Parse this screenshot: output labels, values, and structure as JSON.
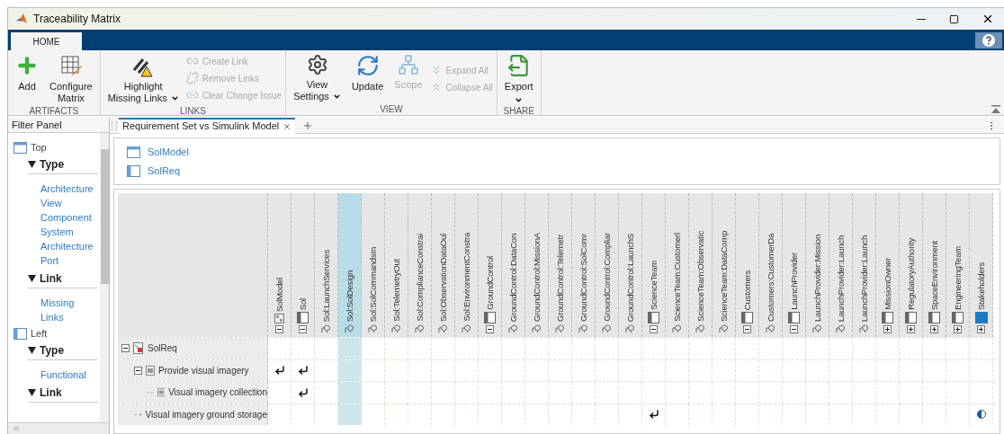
{
  "window": {
    "title": "Traceability Matrix"
  },
  "ribbon": {
    "tabs": [
      {
        "label": "HOME",
        "selected": true
      }
    ],
    "groups": [
      {
        "label": "ARTIFACTS",
        "items": [
          {
            "kind": "large",
            "lines": [
              "Add"
            ],
            "disabled": false,
            "dropdown": false
          },
          {
            "kind": "large",
            "lines": [
              "Configure",
              "Matrix"
            ],
            "disabled": false,
            "dropdown": false
          }
        ]
      },
      {
        "label": "LINKS",
        "items": [
          {
            "kind": "large",
            "lines": [
              "Highlight",
              "Missing Links"
            ],
            "disabled": false,
            "dropdown": true
          },
          {
            "kind": "stack",
            "items": [
              {
                "label": "Create Link",
                "disabled": true
              },
              {
                "label": "Remove Links",
                "disabled": true
              },
              {
                "label": "Clear Change Issue",
                "disabled": true
              }
            ]
          }
        ]
      },
      {
        "label": "VIEW",
        "items": [
          {
            "kind": "large",
            "lines": [
              "View",
              "Settings"
            ],
            "disabled": false,
            "dropdown": true
          },
          {
            "kind": "large",
            "lines": [
              "Update"
            ],
            "disabled": false,
            "dropdown": false
          },
          {
            "kind": "large",
            "lines": [
              "Scope"
            ],
            "disabled": true,
            "dropdown": false
          },
          {
            "kind": "stack",
            "items": [
              {
                "label": "Expand All",
                "disabled": true
              },
              {
                "label": "Collapse All",
                "disabled": true
              }
            ]
          }
        ]
      },
      {
        "label": "SHARE",
        "items": [
          {
            "kind": "large",
            "lines": [
              "Export"
            ],
            "disabled": false,
            "dropdown": true
          }
        ]
      }
    ]
  },
  "filter_panel": {
    "title": "Filter Panel",
    "sections": [
      {
        "label": "Top",
        "kind": "top",
        "groups": [
          {
            "label": "Type",
            "expanded": true,
            "items": [
              "Architecture View",
              "Component",
              "System Architecture Port"
            ]
          },
          {
            "label": "Link",
            "expanded": true,
            "items": [
              "Missing Links"
            ]
          }
        ]
      },
      {
        "label": "Left",
        "kind": "left",
        "groups": [
          {
            "label": "Type",
            "expanded": true,
            "items": [
              "Functional"
            ]
          },
          {
            "label": "Link",
            "expanded": true
          }
        ]
      }
    ]
  },
  "document_tabs": [
    {
      "label": "Requirement Set vs Simulink Model",
      "selected": true
    }
  ],
  "legend": [
    {
      "label": "SolModel",
      "kind": "top"
    },
    {
      "label": "SolReq",
      "kind": "left"
    }
  ],
  "matrix": {
    "columns": [
      {
        "label": "SolModel",
        "kind": "model",
        "expanded": true,
        "selected": false
      },
      {
        "label": "Sol",
        "kind": "component",
        "expanded": true,
        "selected": false
      },
      {
        "label": "Sol:LaunchServices",
        "kind": "port",
        "selected": false
      },
      {
        "label": "Sol:SolDesign",
        "kind": "port",
        "selected": true
      },
      {
        "label": "Sol:SolCommandsIn",
        "kind": "port",
        "selected": false
      },
      {
        "label": "Sol:TelemetryOut",
        "kind": "port",
        "selected": false
      },
      {
        "label": "Sol:ComplianceConstrai",
        "kind": "port",
        "selected": false
      },
      {
        "label": "Sol:ObservationDataOul",
        "kind": "port",
        "selected": false
      },
      {
        "label": "Sol:EnvironmentConstra",
        "kind": "port",
        "selected": false
      },
      {
        "label": "GroundControl",
        "kind": "component",
        "expanded": true,
        "selected": false
      },
      {
        "label": "GroundControl:DataCon",
        "kind": "port",
        "selected": false
      },
      {
        "label": "GroundControl:MissionA",
        "kind": "port",
        "selected": false
      },
      {
        "label": "GroundControl:Telemetr",
        "kind": "port",
        "selected": false
      },
      {
        "label": "GroundControl:SolComr",
        "kind": "port",
        "selected": false
      },
      {
        "label": "GroundControl:Compliar",
        "kind": "port",
        "selected": false
      },
      {
        "label": "GroundControl:LaunchS",
        "kind": "port",
        "selected": false
      },
      {
        "label": "ScienceTeam",
        "kind": "component",
        "expanded": true,
        "selected": false
      },
      {
        "label": "ScienceTeam:Customerl",
        "kind": "port",
        "selected": false
      },
      {
        "label": "ScienceTeam:Observatic",
        "kind": "port",
        "selected": false
      },
      {
        "label": "ScienceTeam:DataComp",
        "kind": "port",
        "selected": false
      },
      {
        "label": "Customers",
        "kind": "component",
        "expanded": true,
        "selected": false
      },
      {
        "label": "Customers:CustomerDa",
        "kind": "port",
        "selected": false
      },
      {
        "label": "LaunchProvider",
        "kind": "component",
        "expanded": true,
        "selected": false
      },
      {
        "label": "LaunchProvider:Mission",
        "kind": "port",
        "selected": false
      },
      {
        "label": "LaunchProvider:Launch",
        "kind": "port",
        "selected": false
      },
      {
        "label": "LaunchProvider:Launch",
        "kind": "port",
        "selected": false
      },
      {
        "label": "MissionOwner",
        "kind": "component",
        "expanded": false,
        "selected": false
      },
      {
        "label": "RegulatoryAuthority",
        "kind": "component",
        "expanded": false,
        "selected": false
      },
      {
        "label": "SpaceEnvironment",
        "kind": "component",
        "expanded": false,
        "selected": false
      },
      {
        "label": "EngineeringTeam",
        "kind": "component",
        "expanded": false,
        "selected": false
      },
      {
        "label": "Stakeholders",
        "kind": "stakeholder",
        "expanded": false,
        "selected": false
      }
    ],
    "rows": [
      {
        "label": "SolReq",
        "kind": "set",
        "expanded": true,
        "children": [
          {
            "label": "Provide visual imagery",
            "kind": "requirement",
            "expanded": true,
            "cells": [
              {
                "kind": "link"
              },
              {
                "kind": "link"
              }
            ],
            "children": [
              {
                "label": "Visual imagery collection",
                "kind": "requirement",
                "cells": [
                  {
                    "kind": "none"
                  },
                  {
                    "kind": "link"
                  }
                ]
              }
            ]
          },
          {
            "label": "Visual imagery ground storage",
            "kind": "requirement",
            "cells": [
              {
                "kind": "none"
              },
              {
                "kind": "none"
              },
              {
                "kind": "none"
              },
              {
                "kind": "none"
              },
              {
                "kind": "none"
              },
              {
                "kind": "none"
              },
              {
                "kind": "none"
              },
              {
                "kind": "none"
              },
              {
                "kind": "none"
              },
              {
                "kind": "none"
              },
              {
                "kind": "none"
              },
              {
                "kind": "none"
              },
              {
                "kind": "none"
              },
              {
                "kind": "none"
              },
              {
                "kind": "none"
              },
              {
                "kind": "none"
              },
              {
                "kind": "link"
              },
              {
                "kind": "none"
              },
              {
                "kind": "none"
              },
              {
                "kind": "none"
              },
              {
                "kind": "none"
              },
              {
                "kind": "none"
              },
              {
                "kind": "none"
              },
              {
                "kind": "none"
              },
              {
                "kind": "none"
              },
              {
                "kind": "none"
              },
              {
                "kind": "none"
              },
              {
                "kind": "none"
              },
              {
                "kind": "none"
              },
              {
                "kind": "none"
              },
              {
                "kind": "partial"
              }
            ]
          }
        ]
      }
    ]
  }
}
